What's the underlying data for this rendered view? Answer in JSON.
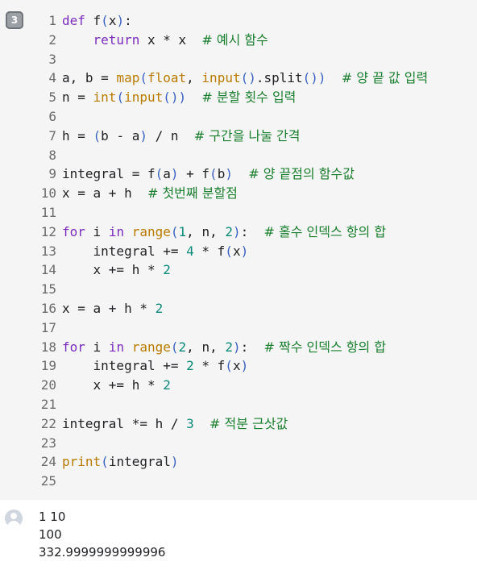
{
  "run_badge": "3",
  "code": [
    {
      "n": "1",
      "tokens": [
        [
          "kw",
          "def"
        ],
        [
          "p",
          " f"
        ],
        [
          "par",
          "("
        ],
        [
          "p",
          "x"
        ],
        [
          "par",
          ")"
        ],
        [
          "p",
          ":"
        ]
      ]
    },
    {
      "n": "2",
      "tokens": [
        [
          "p",
          "    "
        ],
        [
          "kw",
          "return"
        ],
        [
          "p",
          " x * x  "
        ],
        [
          "cmt",
          "# 예시 함수"
        ]
      ]
    },
    {
      "n": "3",
      "tokens": []
    },
    {
      "n": "4",
      "tokens": [
        [
          "p",
          "a, b = "
        ],
        [
          "bi",
          "map"
        ],
        [
          "par",
          "("
        ],
        [
          "bi",
          "float"
        ],
        [
          "p",
          ", "
        ],
        [
          "bi",
          "input"
        ],
        [
          "par",
          "()"
        ],
        [
          "p",
          ".split"
        ],
        [
          "par",
          "()"
        ],
        [
          "par",
          ")"
        ],
        [
          "p",
          "  "
        ],
        [
          "cmt",
          "# 양 끝 값 입력"
        ]
      ]
    },
    {
      "n": "5",
      "tokens": [
        [
          "p",
          "n = "
        ],
        [
          "bi",
          "int"
        ],
        [
          "par",
          "("
        ],
        [
          "bi",
          "input"
        ],
        [
          "par",
          "()"
        ],
        [
          "par",
          ")"
        ],
        [
          "p",
          "  "
        ],
        [
          "cmt",
          "# 분할 횟수 입력"
        ]
      ]
    },
    {
      "n": "6",
      "tokens": []
    },
    {
      "n": "7",
      "tokens": [
        [
          "p",
          "h = "
        ],
        [
          "par",
          "("
        ],
        [
          "p",
          "b - a"
        ],
        [
          "par",
          ")"
        ],
        [
          "p",
          " / n  "
        ],
        [
          "cmt",
          "# 구간을 나눌 간격"
        ]
      ]
    },
    {
      "n": "8",
      "tokens": []
    },
    {
      "n": "9",
      "tokens": [
        [
          "p",
          "integral = f"
        ],
        [
          "par",
          "("
        ],
        [
          "p",
          "a"
        ],
        [
          "par",
          ")"
        ],
        [
          "p",
          " + f"
        ],
        [
          "par",
          "("
        ],
        [
          "p",
          "b"
        ],
        [
          "par",
          ")"
        ],
        [
          "p",
          "  "
        ],
        [
          "cmt",
          "# 양 끝점의 함수값"
        ]
      ]
    },
    {
      "n": "10",
      "tokens": [
        [
          "p",
          "x = a + h  "
        ],
        [
          "cmt",
          "# 첫번째 분할점"
        ]
      ]
    },
    {
      "n": "11",
      "tokens": []
    },
    {
      "n": "12",
      "tokens": [
        [
          "kw",
          "for"
        ],
        [
          "p",
          " i "
        ],
        [
          "kw",
          "in"
        ],
        [
          "p",
          " "
        ],
        [
          "bi",
          "range"
        ],
        [
          "par",
          "("
        ],
        [
          "num",
          "1"
        ],
        [
          "p",
          ", n, "
        ],
        [
          "num",
          "2"
        ],
        [
          "par",
          ")"
        ],
        [
          "p",
          ":  "
        ],
        [
          "cmt",
          "# 홀수 인덱스 항의 합"
        ]
      ]
    },
    {
      "n": "13",
      "tokens": [
        [
          "p",
          "    integral += "
        ],
        [
          "num",
          "4"
        ],
        [
          "p",
          " * f"
        ],
        [
          "par",
          "("
        ],
        [
          "p",
          "x"
        ],
        [
          "par",
          ")"
        ]
      ]
    },
    {
      "n": "14",
      "tokens": [
        [
          "p",
          "    x += h * "
        ],
        [
          "num",
          "2"
        ]
      ]
    },
    {
      "n": "15",
      "tokens": []
    },
    {
      "n": "16",
      "tokens": [
        [
          "p",
          "x = a + h * "
        ],
        [
          "num",
          "2"
        ]
      ]
    },
    {
      "n": "17",
      "tokens": []
    },
    {
      "n": "18",
      "tokens": [
        [
          "kw",
          "for"
        ],
        [
          "p",
          " i "
        ],
        [
          "kw",
          "in"
        ],
        [
          "p",
          " "
        ],
        [
          "bi",
          "range"
        ],
        [
          "par",
          "("
        ],
        [
          "num",
          "2"
        ],
        [
          "p",
          ", n, "
        ],
        [
          "num",
          "2"
        ],
        [
          "par",
          ")"
        ],
        [
          "p",
          ":  "
        ],
        [
          "cmt",
          "# 짝수 인덱스 항의 합"
        ]
      ]
    },
    {
      "n": "19",
      "tokens": [
        [
          "p",
          "    integral += "
        ],
        [
          "num",
          "2"
        ],
        [
          "p",
          " * f"
        ],
        [
          "par",
          "("
        ],
        [
          "p",
          "x"
        ],
        [
          "par",
          ")"
        ]
      ]
    },
    {
      "n": "20",
      "tokens": [
        [
          "p",
          "    x += h * "
        ],
        [
          "num",
          "2"
        ]
      ]
    },
    {
      "n": "21",
      "tokens": []
    },
    {
      "n": "22",
      "tokens": [
        [
          "p",
          "integral *= h / "
        ],
        [
          "num",
          "3"
        ],
        [
          "p",
          "  "
        ],
        [
          "cmt",
          "# 적분 근삿값"
        ]
      ]
    },
    {
      "n": "23",
      "tokens": []
    },
    {
      "n": "24",
      "tokens": [
        [
          "bi",
          "print"
        ],
        [
          "par",
          "("
        ],
        [
          "p",
          "integral"
        ],
        [
          "par",
          ")"
        ]
      ]
    },
    {
      "n": "25",
      "tokens": []
    }
  ],
  "output": [
    "1 10",
    "100",
    "332.9999999999996"
  ]
}
